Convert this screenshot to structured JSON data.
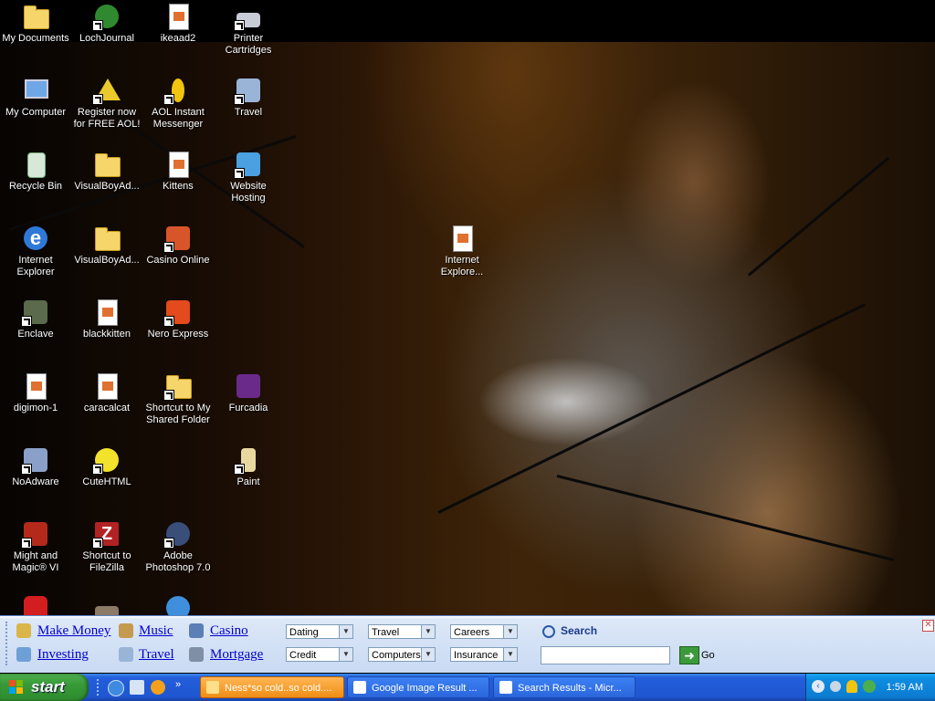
{
  "desktop": {
    "icons": [
      {
        "label": "My Documents"
      },
      {
        "label": "LochJournal"
      },
      {
        "label": "ikeaad2"
      },
      {
        "label": "Printer Cartridges"
      },
      {
        "label": "My Computer"
      },
      {
        "label": "Register now for FREE AOL!"
      },
      {
        "label": "AOL Instant Messenger"
      },
      {
        "label": "Travel"
      },
      {
        "label": "Recycle Bin"
      },
      {
        "label": "VisualBoyAd..."
      },
      {
        "label": "Kittens"
      },
      {
        "label": "Website Hosting"
      },
      {
        "label": "Internet Explorer"
      },
      {
        "label": "VisualBoyAd..."
      },
      {
        "label": "Casino  Online"
      },
      {
        "label": "Internet Explore..."
      },
      {
        "label": "Enclave"
      },
      {
        "label": "blackkitten"
      },
      {
        "label": "Nero Express"
      },
      {
        "label": "digimon-1"
      },
      {
        "label": "caracalcat"
      },
      {
        "label": "Shortcut to My Shared Folder"
      },
      {
        "label": "Furcadia"
      },
      {
        "label": "NoAdware"
      },
      {
        "label": "CuteHTML"
      },
      {
        "label": "Paint"
      },
      {
        "label": "Might and Magic® VI"
      },
      {
        "label": "Shortcut to FileZilla"
      },
      {
        "label": "Adobe Photoshop 7.0"
      }
    ]
  },
  "toolbar": {
    "links": [
      "Make Money",
      "Music",
      "Casino",
      "Investing",
      "Travel",
      "Mortgage"
    ],
    "selects": [
      "Dating",
      "Travel",
      "Careers",
      "Credit",
      "Computers",
      "Insurance"
    ],
    "search_label": "Search",
    "go_label": "Go"
  },
  "taskbar": {
    "start_label": "start",
    "windows": [
      "Ness*so cold..so cold....",
      "Google Image Result ...",
      "Search Results - Micr..."
    ],
    "clock": "1:59 AM"
  },
  "colors": {
    "taskbar_blue": "#245edb",
    "start_green": "#379a37",
    "active_task_orange": "#f08e14",
    "toolbar_link": "#0000cc"
  }
}
